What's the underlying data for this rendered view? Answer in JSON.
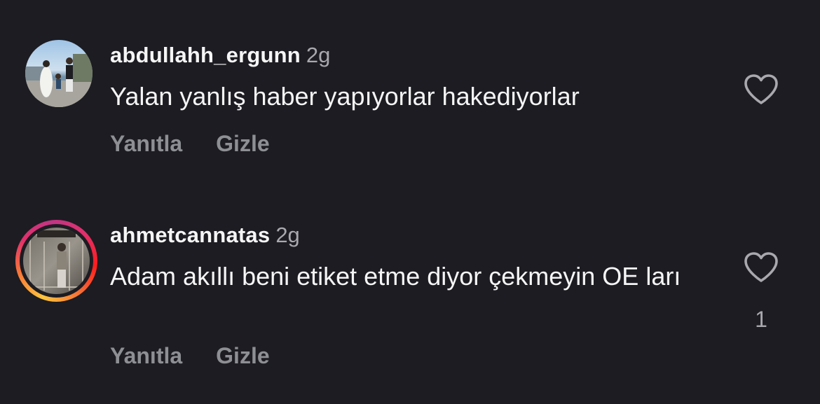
{
  "colors": {
    "background": "#1c1c22",
    "text_primary": "#f5f5f5",
    "text_secondary": "#a8a8ae",
    "action_text": "#8e8e95"
  },
  "comments": [
    {
      "username": "abdullahh_ergunn",
      "time": "2g",
      "text": "Yalan yanlış haber yapıyorlar hakediyorlar",
      "reply_label": "Yanıtla",
      "hide_label": "Gizle",
      "like_icon": "heart-outline-icon",
      "has_story_ring": false
    },
    {
      "username": "ahmetcannatas",
      "time": "2g",
      "text": "Adam akıllı beni etiket etme diyor çekmeyin OE ları",
      "reply_label": "Yanıtla",
      "hide_label": "Gizle",
      "like_icon": "heart-outline-icon",
      "like_count": "1",
      "has_story_ring": true
    }
  ]
}
